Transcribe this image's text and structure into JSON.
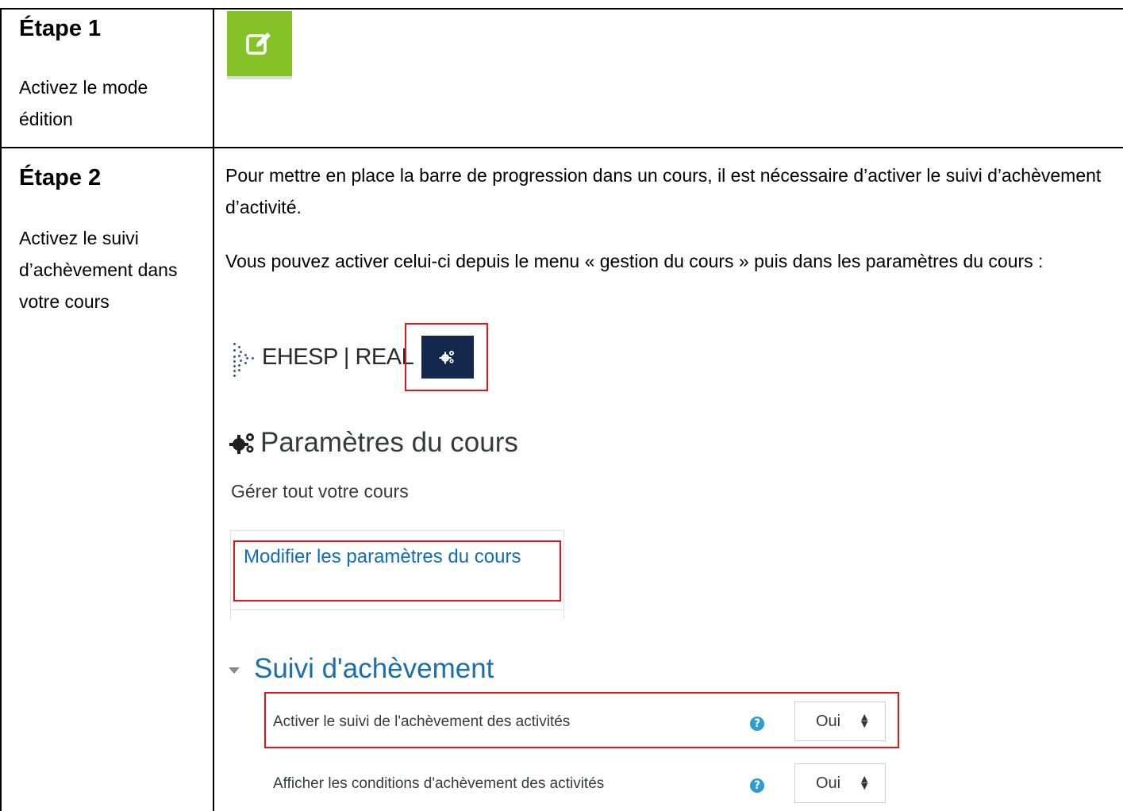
{
  "steps": [
    {
      "title": "Étape 1",
      "description": "Activez le mode édition"
    },
    {
      "title": "Étape 2",
      "description": "Activez le suivi d’achèvement dans votre cours"
    }
  ],
  "step2": {
    "paragraph1": "Pour mettre en place la barre de progression dans un cours, il est nécessaire d’activer le suivi d’achèvement d’activité.",
    "paragraph2": "Vous pouvez activer celui-ci depuis le menu « gestion du cours » puis dans les paramètres du cours :"
  },
  "screenshot": {
    "brand": "EHESP | REAL",
    "settings_title": "Paramètres du cours",
    "manage_text": "Gérer tout votre cours",
    "edit_link": "Modifier les paramètres du cours",
    "section_title": "Suivi d'achèvement",
    "fields": [
      {
        "label": "Activer le suivi de l'achèvement des activités",
        "value": "Oui"
      },
      {
        "label": "Afficher les conditions d'achèvement des activités",
        "value": "Oui"
      }
    ],
    "icons": {
      "edit": "pencil-square-icon",
      "gear": "gears-icon",
      "help": "question-circle-icon"
    }
  },
  "colors": {
    "edit_button": "#84c225",
    "gear_button": "#13284a",
    "highlight_frame": "#e3151a",
    "link": "#0f6cbf",
    "section_title": "#1a6fae",
    "help_icon": "#2d9ccf"
  }
}
